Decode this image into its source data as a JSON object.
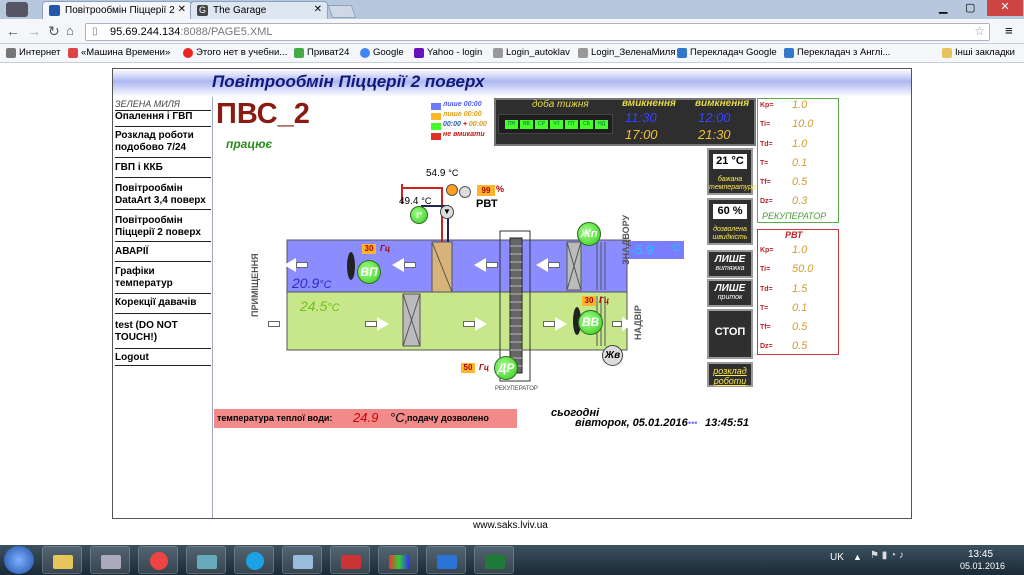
{
  "browser": {
    "tabs": [
      {
        "label": "Повітрообмін Піццерії 2"
      },
      {
        "label": "The Garage"
      }
    ],
    "url_host": "95.69.244.134",
    "url_rest": ":8088/PAGE5.XML",
    "bookmarks": [
      "Интернет",
      "«Машина Времени»",
      "Этого нет в учебни...",
      "Приват24",
      "Google",
      "Yahoo - login",
      "Login_autoklav",
      "Login_ЗеленаМиля",
      "Перекладач Google",
      "Перекладач з Англі...",
      "Інші закладки"
    ]
  },
  "page": {
    "title": "Повітрообмін Піццерії 2 поверх",
    "nav_header": "ЗЕЛЕНА МИЛЯ",
    "nav": [
      "Опалення і ГВП",
      "Розклад роботи подобово 7/24",
      "ГВП і ККБ",
      "Повітрообмін DataArt 3,4 поверх",
      "Повітрообмін Піццерії 2 поверх",
      "АВАРІЇ",
      "Графіки температур",
      "Корекції давачів",
      "test (DO NOT TOUCH!)",
      "Logout"
    ],
    "footer": "www.saks.lviv.ua"
  },
  "scada": {
    "unit_name": "ПВС_2",
    "status": "працює",
    "legend": {
      "only_0000": "лише 00:00",
      "only_0000_b": "лише 00:00",
      "range": "00:00 + 00:00",
      "disabled": "не вмикати",
      "range_a": "00:00",
      "range_b": "00:00"
    },
    "schedule": {
      "day_header": "доба тижня",
      "on_header": "вмикнення",
      "off_header": "вимкнення",
      "days": [
        "ПН",
        "ВВ",
        "СР",
        "ЧТ",
        "ПТ",
        "СБ",
        "НД"
      ],
      "on1": "11:30",
      "off1": "12:00",
      "on2": "17:00",
      "off2": "21:30"
    },
    "temps": {
      "water_top": "54.9",
      "water_ret": "49.4",
      "outdoor": "-5.9",
      "room": "20.9",
      "supply": "24.5",
      "unit": "°C",
      "unit_short": "°C"
    },
    "valve_pct": "99",
    "valve_unit": "%",
    "rvt_label": "РВТ",
    "fans": {
      "vp": "ВП",
      "vv": "ВВ",
      "dr": "ДР",
      "zhp": "Жп",
      "zhv": "Жв",
      "t": "t°",
      "vp_hz": "30",
      "vv_hz": "30",
      "dr_hz": "50",
      "hz_unit": "Гц"
    },
    "labels": {
      "room_vert": "ПРИМІЩЕННЯ",
      "outside_vert": "ЗНАДВОРУ",
      "exhaust_vert": "НАДВІР",
      "recuperator": "РЕКУПЕРАТОР"
    },
    "side": {
      "set_temp": "21 °C",
      "set_temp_label": "бажана температура",
      "speed": "60 %",
      "speed_label": "дозволена швидкість",
      "only_exhaust": "ЛИШЕ",
      "only_exhaust_sub": "витяжка",
      "only_supply": "ЛИШЕ",
      "only_supply_sub": "приток",
      "stop": "СТОП",
      "schedule_link": "розклад роботи"
    },
    "pid_recup": {
      "title": "РЕКУПЕРАТОР",
      "rows": [
        {
          "k": "Kp=",
          "v": "1.0"
        },
        {
          "k": "Ti=",
          "v": "10.0"
        },
        {
          "k": "Td=",
          "v": "1.0"
        },
        {
          "k": "T=",
          "v": "0.1"
        },
        {
          "k": "Tf=",
          "v": "0.5"
        },
        {
          "k": "Dz=",
          "v": "0.3"
        }
      ]
    },
    "pid_rvt": {
      "title": "РВТ",
      "rows": [
        {
          "k": "Kp=",
          "v": "1.0"
        },
        {
          "k": "Ti=",
          "v": "50.0"
        },
        {
          "k": "Td=",
          "v": "1.5"
        },
        {
          "k": "T=",
          "v": "0.1"
        },
        {
          "k": "Tf=",
          "v": "0.5"
        },
        {
          "k": "Dz=",
          "v": "0.5"
        }
      ]
    },
    "water_label": "температура теплої води:",
    "water_value": "24.9",
    "water_unit": "°С,",
    "water_status": "подачу дозволено",
    "today_label": "сьогодні",
    "today_date": "вівторок, 05.01.2016",
    "today_time": "13:45:51",
    "today_dots": "•••"
  },
  "taskbar": {
    "lang": "UK",
    "time": "13:45",
    "date": "05.01.2016"
  },
  "colors": {
    "accent": "#111a7a",
    "supply_duct": "#c8e68a",
    "exhaust_duct": "#8b8dff",
    "fan": "#39d41c"
  }
}
